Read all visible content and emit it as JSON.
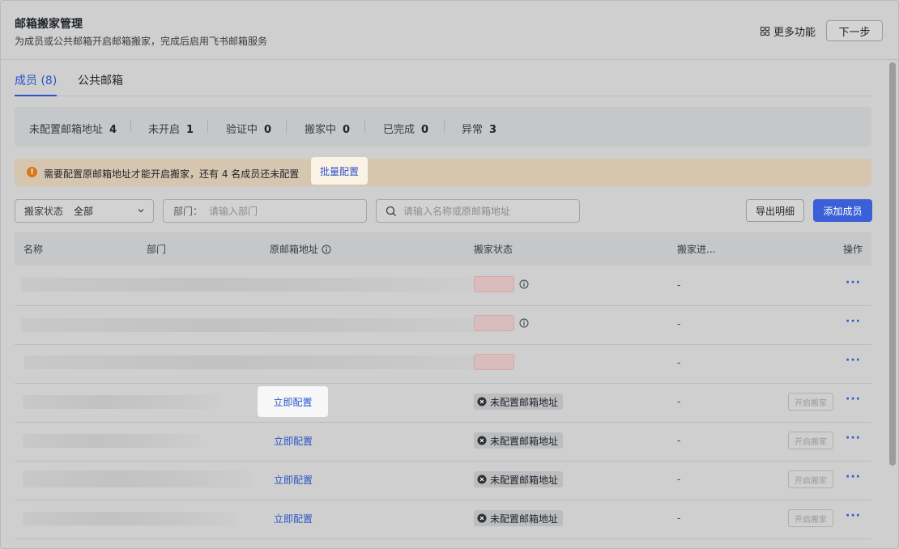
{
  "header": {
    "title": "邮箱搬家管理",
    "subtitle": "为成员或公共邮箱开启邮箱搬家，完成后启用飞书邮箱服务",
    "more_label": "更多功能",
    "next_label": "下一步"
  },
  "tabs": [
    {
      "label": "成员 (8)",
      "active": true
    },
    {
      "label": "公共邮箱",
      "active": false
    }
  ],
  "stats": [
    {
      "label": "未配置邮箱地址",
      "value": "4"
    },
    {
      "label": "未开启",
      "value": "1"
    },
    {
      "label": "验证中",
      "value": "0"
    },
    {
      "label": "搬家中",
      "value": "0"
    },
    {
      "label": "已完成",
      "value": "0"
    },
    {
      "label": "异常",
      "value": "3"
    }
  ],
  "alert": {
    "text": "需要配置原邮箱地址才能开启搬家，还有 4 名成员还未配置",
    "link": "批量配置"
  },
  "filters": {
    "status_label": "搬家状态",
    "status_value": "全部",
    "dept_label": "部门：",
    "dept_placeholder": "请输入部门",
    "search_placeholder": "请输入名称或原邮箱地址",
    "export_label": "导出明细",
    "add_label": "添加成员"
  },
  "table": {
    "columns": [
      "名称",
      "部门",
      "原邮箱地址",
      "搬家状态",
      "搬家进...",
      "操作"
    ],
    "rows": [
      {
        "progress": "-",
        "more": "···"
      },
      {
        "progress": "-",
        "more": "···"
      },
      {
        "progress": "-",
        "more": "···"
      },
      {
        "config": "立即配置",
        "status": "未配置邮箱地址",
        "progress": "-",
        "start": "开启搬家",
        "more": "···"
      },
      {
        "config": "立即配置",
        "status": "未配置邮箱地址",
        "progress": "-",
        "start": "开启搬家",
        "more": "···"
      },
      {
        "config": "立即配置",
        "status": "未配置邮箱地址",
        "progress": "-",
        "start": "开启搬家",
        "more": "···"
      },
      {
        "config": "立即配置",
        "status": "未配置邮箱地址",
        "progress": "-",
        "start": "开启搬家",
        "more": "···"
      }
    ]
  },
  "colors": {
    "accent": "#2b54c8",
    "primary_button": "#3a5fd6",
    "warning": "#d9771c"
  }
}
